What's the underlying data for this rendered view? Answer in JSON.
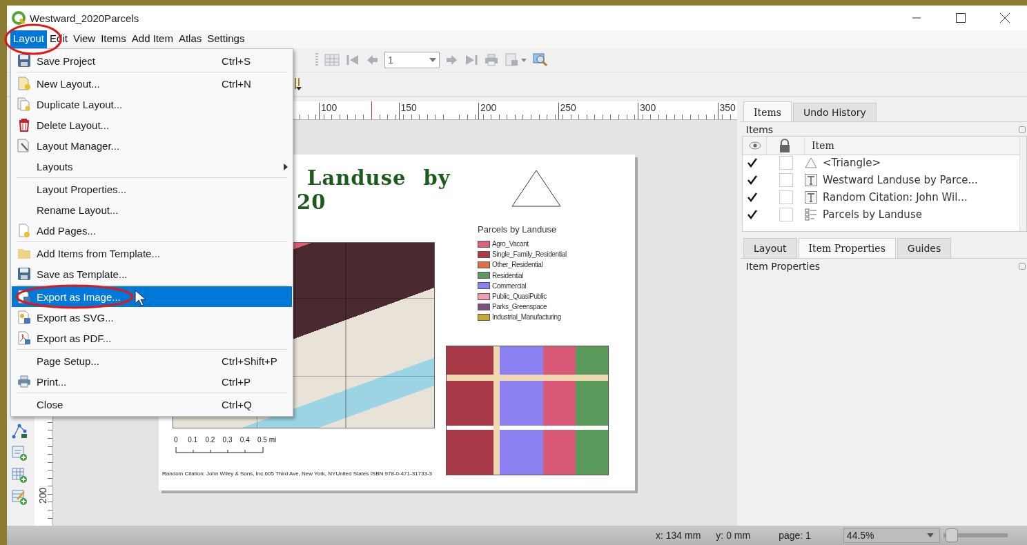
{
  "window": {
    "title": "Westward_2020Parcels"
  },
  "menubar": [
    {
      "label": "Layout",
      "selected": true
    },
    {
      "label": "Edit",
      "selected": false
    },
    {
      "label": "View",
      "selected": false
    },
    {
      "label": "Items",
      "selected": false
    },
    {
      "label": "Add Item",
      "selected": false
    },
    {
      "label": "Atlas",
      "selected": false
    },
    {
      "label": "Settings",
      "selected": false
    }
  ],
  "layout_menu": [
    {
      "kind": "save",
      "label": "Save Project",
      "shortcut": "Ctrl+S",
      "selected": false
    },
    {
      "kind": "separator"
    },
    {
      "kind": "new",
      "label": "New Layout...",
      "shortcut": "Ctrl+N",
      "selected": false
    },
    {
      "kind": "duplicate",
      "label": "Duplicate Layout...",
      "selected": false
    },
    {
      "kind": "delete",
      "label": "Delete Layout...",
      "selected": false
    },
    {
      "kind": "manager",
      "label": "Layout Manager...",
      "selected": false
    },
    {
      "kind": "submenu",
      "label": "Layouts",
      "selected": false
    },
    {
      "kind": "separator"
    },
    {
      "kind": "plain",
      "label": "Layout Properties...",
      "selected": false
    },
    {
      "kind": "plain",
      "label": "Rename Layout...",
      "selected": false
    },
    {
      "kind": "pages",
      "label": "Add Pages...",
      "selected": false
    },
    {
      "kind": "separator"
    },
    {
      "kind": "folder",
      "label": "Add Items from Template...",
      "selected": false
    },
    {
      "kind": "save",
      "label": "Save as Template...",
      "selected": false
    },
    {
      "kind": "separator"
    },
    {
      "kind": "image",
      "label": "Export as Image...",
      "selected": true
    },
    {
      "kind": "svg",
      "label": "Export as SVG...",
      "selected": false
    },
    {
      "kind": "pdf",
      "label": "Export as PDF...",
      "selected": false
    },
    {
      "kind": "separator"
    },
    {
      "kind": "plain",
      "label": "Page Setup...",
      "shortcut": "Ctrl+Shift+P",
      "selected": false
    },
    {
      "kind": "print",
      "label": "Print...",
      "shortcut": "Ctrl+P",
      "selected": false
    },
    {
      "kind": "separator"
    },
    {
      "kind": "plain",
      "label": "Close",
      "shortcut": "Ctrl+Q",
      "selected": false
    }
  ],
  "toolbar": {
    "page_field": {
      "value": "1"
    }
  },
  "rulers": {
    "top_labels": [
      "100",
      "150",
      "200",
      "250",
      "300",
      "350"
    ],
    "left_labels": [
      "200"
    ]
  },
  "page": {
    "title_lines": [
      "Landuse by",
      "20"
    ],
    "legend": {
      "title": "Parcels by Landuse",
      "items": [
        {
          "label": "Agro_Vacant",
          "color": "#e0607e"
        },
        {
          "label": "Single_Family_Residential",
          "color": "#b03a48"
        },
        {
          "label": "Other_Residential",
          "color": "#e07040"
        },
        {
          "label": "Residential",
          "color": "#5a9a5a"
        },
        {
          "label": "Commercial",
          "color": "#8a80f0"
        },
        {
          "label": "Public_QuasiPublic",
          "color": "#f0a0b0"
        },
        {
          "label": "Parks_Greenspace",
          "color": "#805080"
        },
        {
          "label": "Industrial_Manufacturing",
          "color": "#c8a832"
        }
      ]
    },
    "scale_labels": [
      "0",
      "0.1",
      "0.2",
      "0.3",
      "0.4",
      "0.5 mi"
    ],
    "citation": "Random Citation: John Wiley & Sons, Inc.605 Third Ave, New York, NYUnited States ISBN 978-0-471-31733-3"
  },
  "dock": {
    "top_tabs": [
      {
        "label": "Items",
        "selected": true
      },
      {
        "label": "Undo History",
        "selected": false
      }
    ],
    "items_heading": "Items",
    "column_label": "Item",
    "rows": [
      {
        "kind": "triangle",
        "name": "<Triangle>",
        "visible": true,
        "locked": false
      },
      {
        "kind": "text",
        "name": "Westward Landuse by Parce...",
        "visible": true,
        "locked": false
      },
      {
        "kind": "text",
        "name": "Random Citation: John Wil...",
        "visible": true,
        "locked": false
      },
      {
        "kind": "legend",
        "name": "Parcels by Landuse",
        "visible": true,
        "locked": false
      }
    ],
    "bottom_tabs": [
      {
        "label": "Layout",
        "selected": false
      },
      {
        "label": "Item Properties",
        "selected": true
      },
      {
        "label": "Guides",
        "selected": false
      }
    ],
    "properties_heading": "Item Properties"
  },
  "status_bar": {
    "x": "x: 134 mm",
    "y": "y: 0 mm",
    "page": "page: 1",
    "zoom": "44.5%",
    "zoom_slider": {
      "level": 0.04
    }
  }
}
